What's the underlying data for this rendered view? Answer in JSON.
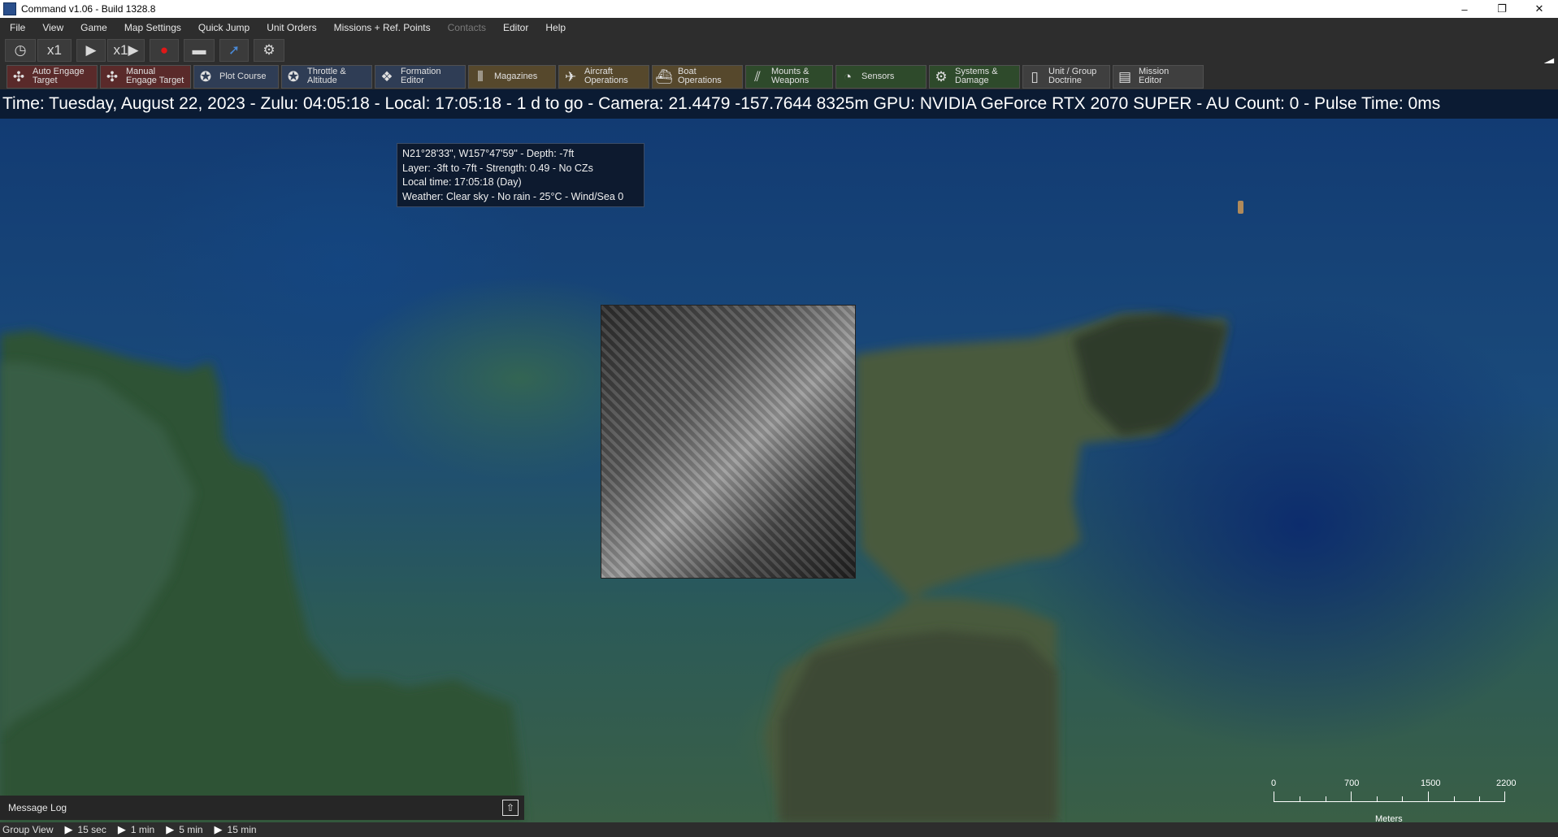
{
  "window": {
    "title": "Command v1.06 - Build 1328.8",
    "minimize": "–",
    "restore": "❐",
    "close": "✕"
  },
  "menu": [
    "File",
    "View",
    "Game",
    "Map Settings",
    "Quick Jump",
    "Unit Orders",
    "Missions + Ref. Points",
    "Contacts",
    "Editor",
    "Help"
  ],
  "time_controls": {
    "speed_label_1": "x1",
    "speed_label_2": "x1"
  },
  "toolbar": [
    {
      "line1": "Auto Engage",
      "line2": "Target",
      "icon": "crosshair-icon"
    },
    {
      "line1": "Manual",
      "line2": "Engage Target",
      "icon": "crosshair-icon"
    },
    {
      "line1": "Plot Course",
      "line2": "",
      "icon": "course-icon"
    },
    {
      "line1": "Throttle &",
      "line2": "Altitude",
      "icon": "throttle-icon"
    },
    {
      "line1": "Formation",
      "line2": "Editor",
      "icon": "formation-icon"
    },
    {
      "line1": "Magazines",
      "line2": "",
      "icon": "magazines-icon"
    },
    {
      "line1": "Aircraft",
      "line2": "Operations",
      "icon": "aircraft-icon"
    },
    {
      "line1": "Boat",
      "line2": "Operations",
      "icon": "boat-icon"
    },
    {
      "line1": "Mounts &",
      "line2": "Weapons",
      "icon": "weapons-icon"
    },
    {
      "line1": "Sensors",
      "line2": "",
      "icon": "sensors-icon"
    },
    {
      "line1": "Systems &",
      "line2": "Damage",
      "icon": "gear-icon"
    },
    {
      "line1": "Unit / Group",
      "line2": "Doctrine",
      "icon": "doctrine-icon"
    },
    {
      "line1": "Mission",
      "line2": "Editor",
      "icon": "mission-editor-icon"
    }
  ],
  "info_line": "Time: Tuesday, August 22, 2023 - Zulu: 04:05:18 - Local: 17:05:18 - 1 d to go -  Camera: 21.4479 -157.7644 8325m  GPU: NVIDIA GeForce RTX 2070 SUPER - AU Count: 0 - Pulse Time: 0ms",
  "tooltip": {
    "line1": "N21°28'33\", W157°47'59\" - Depth: -7ft",
    "line2": "Layer: -3ft to -7ft - Strength: 0.49 - No CZs",
    "line3": "Local time: 17:05:18 (Day)",
    "line4": "Weather: Clear sky - No rain - 25°C - Wind/Sea 0"
  },
  "scale_bar": {
    "labels": [
      "0",
      "700",
      "1500",
      "2200"
    ],
    "unit": "Meters"
  },
  "message_log": {
    "label": "Message Log"
  },
  "status_bar": {
    "group_view": "Group View",
    "steps": [
      "15 sec",
      "1 min",
      "5 min",
      "15 min"
    ]
  }
}
